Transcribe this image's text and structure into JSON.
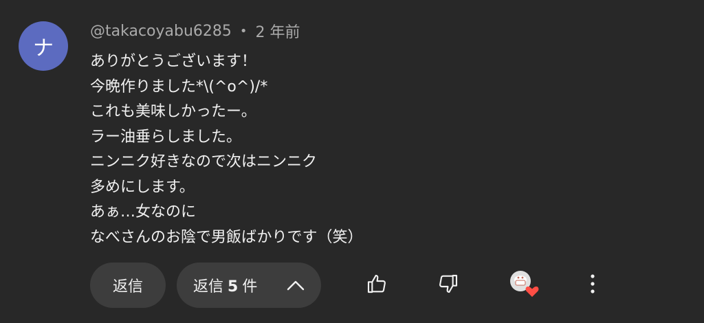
{
  "comment": {
    "avatar_letter": "ナ",
    "avatar_color": "#5c6bc0",
    "author": "@takacoyabu6285",
    "separator": "•",
    "time": "2 年前",
    "lines": [
      "ありがとうございます！",
      "今晩作りました*\\(^o^)/*",
      "これも美味しかったー。",
      "ラー油垂らしました。",
      "ニンニク好きなので次はニンニク",
      "多めにします。",
      "あぁ…女なのに",
      "なべさんのお陰で男飯ばかりです（笑）"
    ]
  },
  "actions": {
    "reply_label": "返信",
    "replies_prefix": "返信",
    "replies_count": "5",
    "replies_suffix": "件",
    "icons": [
      "thumbs-up-icon",
      "thumbs-down-icon",
      "creator-heart-icon",
      "more-vert-icon",
      "chevron-up-icon"
    ]
  }
}
